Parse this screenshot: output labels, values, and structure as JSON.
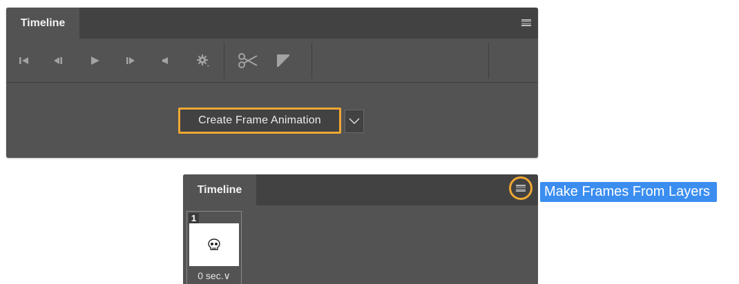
{
  "panel_top": {
    "tab_label": "Timeline",
    "create_button_label": "Create Frame Animation"
  },
  "panel_bottom": {
    "tab_label": "Timeline",
    "frame": {
      "number": "1",
      "delay": "0 sec.∨"
    }
  },
  "menu_item": "Make Frames From Layers",
  "colors": {
    "highlight": "#f0a833",
    "menu_highlight": "#3b8ef0",
    "panel_bg": "#535353",
    "tabbar_bg": "#424242"
  },
  "icons": [
    "first-frame-icon",
    "previous-frame-icon",
    "play-icon",
    "next-frame-icon",
    "audio-icon",
    "settings-gear-icon",
    "scissors-icon",
    "transition-icon",
    "panel-menu-icon",
    "skull-icon"
  ]
}
